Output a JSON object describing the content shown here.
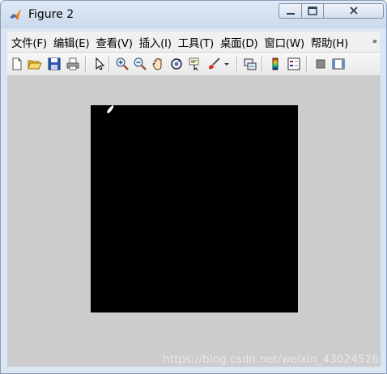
{
  "window": {
    "title": "Figure 2"
  },
  "menu": {
    "items": [
      "文件(F)",
      "编辑(E)",
      "查看(V)",
      "插入(I)",
      "工具(T)",
      "桌面(D)",
      "窗口(W)",
      "帮助(H)"
    ],
    "overflow": "»"
  },
  "toolbar": {
    "buttons": [
      "new-figure-icon",
      "open-file-icon",
      "save-icon",
      "print-icon",
      "pointer-icon",
      "zoom-in-icon",
      "zoom-out-icon",
      "pan-hand-icon",
      "rotate-3d-icon",
      "data-cursor-icon",
      "brush-icon",
      "brush-dropdown-icon",
      "link-plot-icon",
      "colorbar-icon",
      "legend-icon",
      "hide-plot-tools-icon",
      "show-plot-tools-icon"
    ]
  },
  "figure": {
    "background": "#cccccc",
    "axes_color": "#000000",
    "watermark": "https://blog.csdn.net/weixin_43024526"
  }
}
